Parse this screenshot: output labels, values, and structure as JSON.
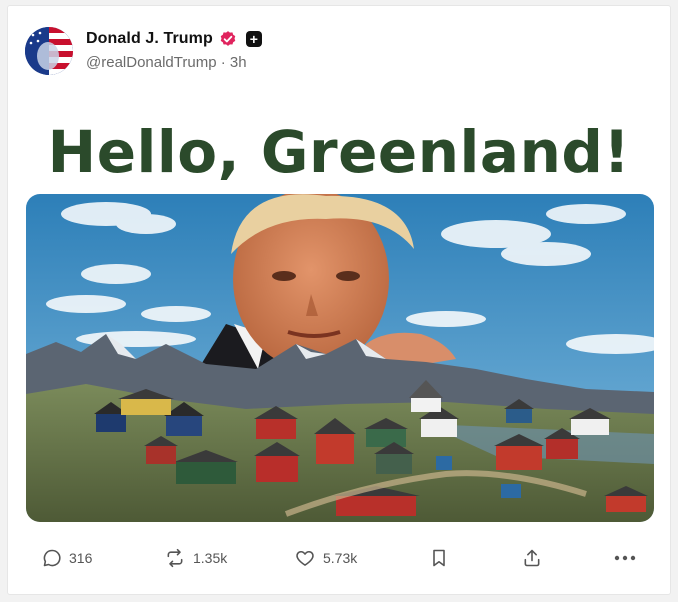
{
  "post": {
    "author": {
      "display_name": "Donald J. Trump",
      "handle": "@realDonaldTrump",
      "separator": "·",
      "time": "3h",
      "verified_color": "#e0245e"
    },
    "headline": "Hello, Greenland!",
    "headline_color": "#2b4a2b",
    "actions": {
      "replies": "316",
      "reposts": "1.35k",
      "likes": "5.73k"
    }
  },
  "icons": [
    "verified-icon",
    "plus-badge-icon",
    "reply-icon",
    "repost-icon",
    "like-icon",
    "bookmark-icon",
    "share-icon",
    "more-icon"
  ]
}
